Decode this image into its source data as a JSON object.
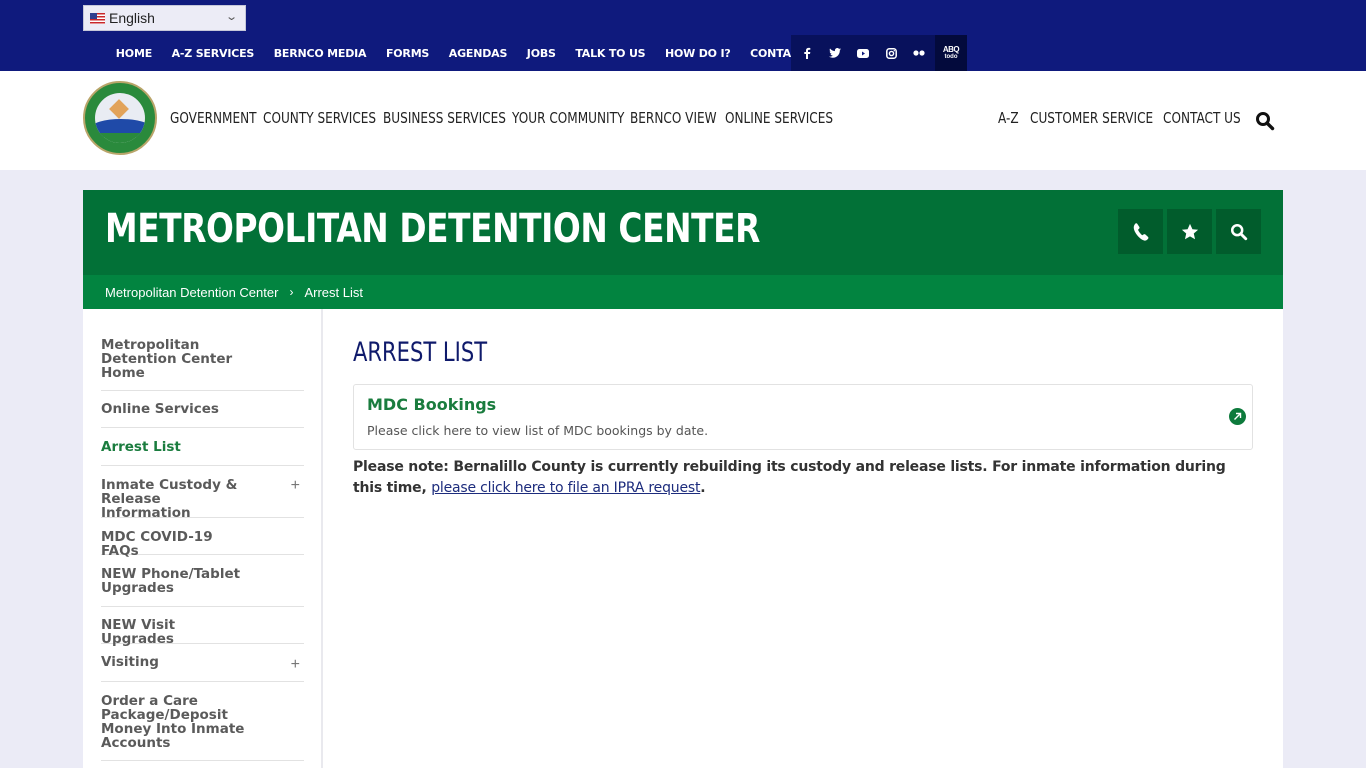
{
  "language_selector": {
    "flag": "us-flag-icon",
    "value": "English"
  },
  "utility_nav": [
    "HOME",
    "A-Z SERVICES",
    "BERNCO MEDIA",
    "FORMS",
    "AGENDAS",
    "JOBS",
    "TALK TO US",
    "HOW DO I?",
    "CONTACT US"
  ],
  "social": [
    {
      "name": "facebook-icon",
      "glyph": "f"
    },
    {
      "name": "twitter-icon",
      "glyph": "t"
    },
    {
      "name": "youtube-icon",
      "glyph": "▶"
    },
    {
      "name": "instagram-icon",
      "glyph": "◎"
    },
    {
      "name": "flickr-icon",
      "glyph": "●●"
    }
  ],
  "abq_todo": {
    "top": "ABQ",
    "bottom": "todo"
  },
  "main_nav": [
    "GOVERNMENT",
    "COUNTY SERVICES",
    "BUSINESS SERVICES",
    "YOUR COMMUNITY",
    "BERNCO VIEW",
    "ONLINE SERVICES"
  ],
  "right_nav": [
    "A-Z",
    "CUSTOMER SERVICE",
    "CONTACT US"
  ],
  "banner": {
    "title": "METROPOLITAN DETENTION CENTER",
    "buttons": [
      "phone-icon",
      "star-icon",
      "search-icon"
    ]
  },
  "breadcrumb": {
    "items": [
      "Metropolitan Detention Center",
      "Arrest List"
    ],
    "separator": "›"
  },
  "sidebar": {
    "items": [
      {
        "label": "Metropolitan Detention Center Home",
        "expandable": false,
        "active": false
      },
      {
        "label": "Online Services",
        "expandable": false,
        "active": false
      },
      {
        "label": "Arrest List",
        "expandable": false,
        "active": true
      },
      {
        "label": "Inmate Custody & Release Information",
        "expandable": true,
        "active": false
      },
      {
        "label": "MDC COVID-19 FAQs",
        "expandable": false,
        "active": false
      },
      {
        "label": "NEW Phone/Tablet Upgrades",
        "expandable": false,
        "active": false
      },
      {
        "label": "NEW Visit Upgrades",
        "expandable": false,
        "active": false
      },
      {
        "label": "Visiting",
        "expandable": true,
        "active": false
      },
      {
        "label": "Order a Care Package/Deposit Money Into Inmate Accounts",
        "expandable": false,
        "active": false
      }
    ],
    "expand_glyph": "+"
  },
  "main": {
    "title": "ARREST LIST",
    "card": {
      "title": "MDC Bookings",
      "description": "Please click here to view list of MDC bookings by date."
    },
    "note": {
      "text": "Please note: Bernalillo County is currently rebuilding its custody and release lists. For inmate information during this time, ",
      "link": "please click here to file an IPRA request",
      "suffix": "."
    }
  },
  "colors": {
    "top_bar": "#0f1a7d",
    "banner_green": "#027137",
    "breadcrumb_green": "#028440",
    "active_link": "#1a7c3e",
    "heading_navy": "#0f1a6b"
  }
}
